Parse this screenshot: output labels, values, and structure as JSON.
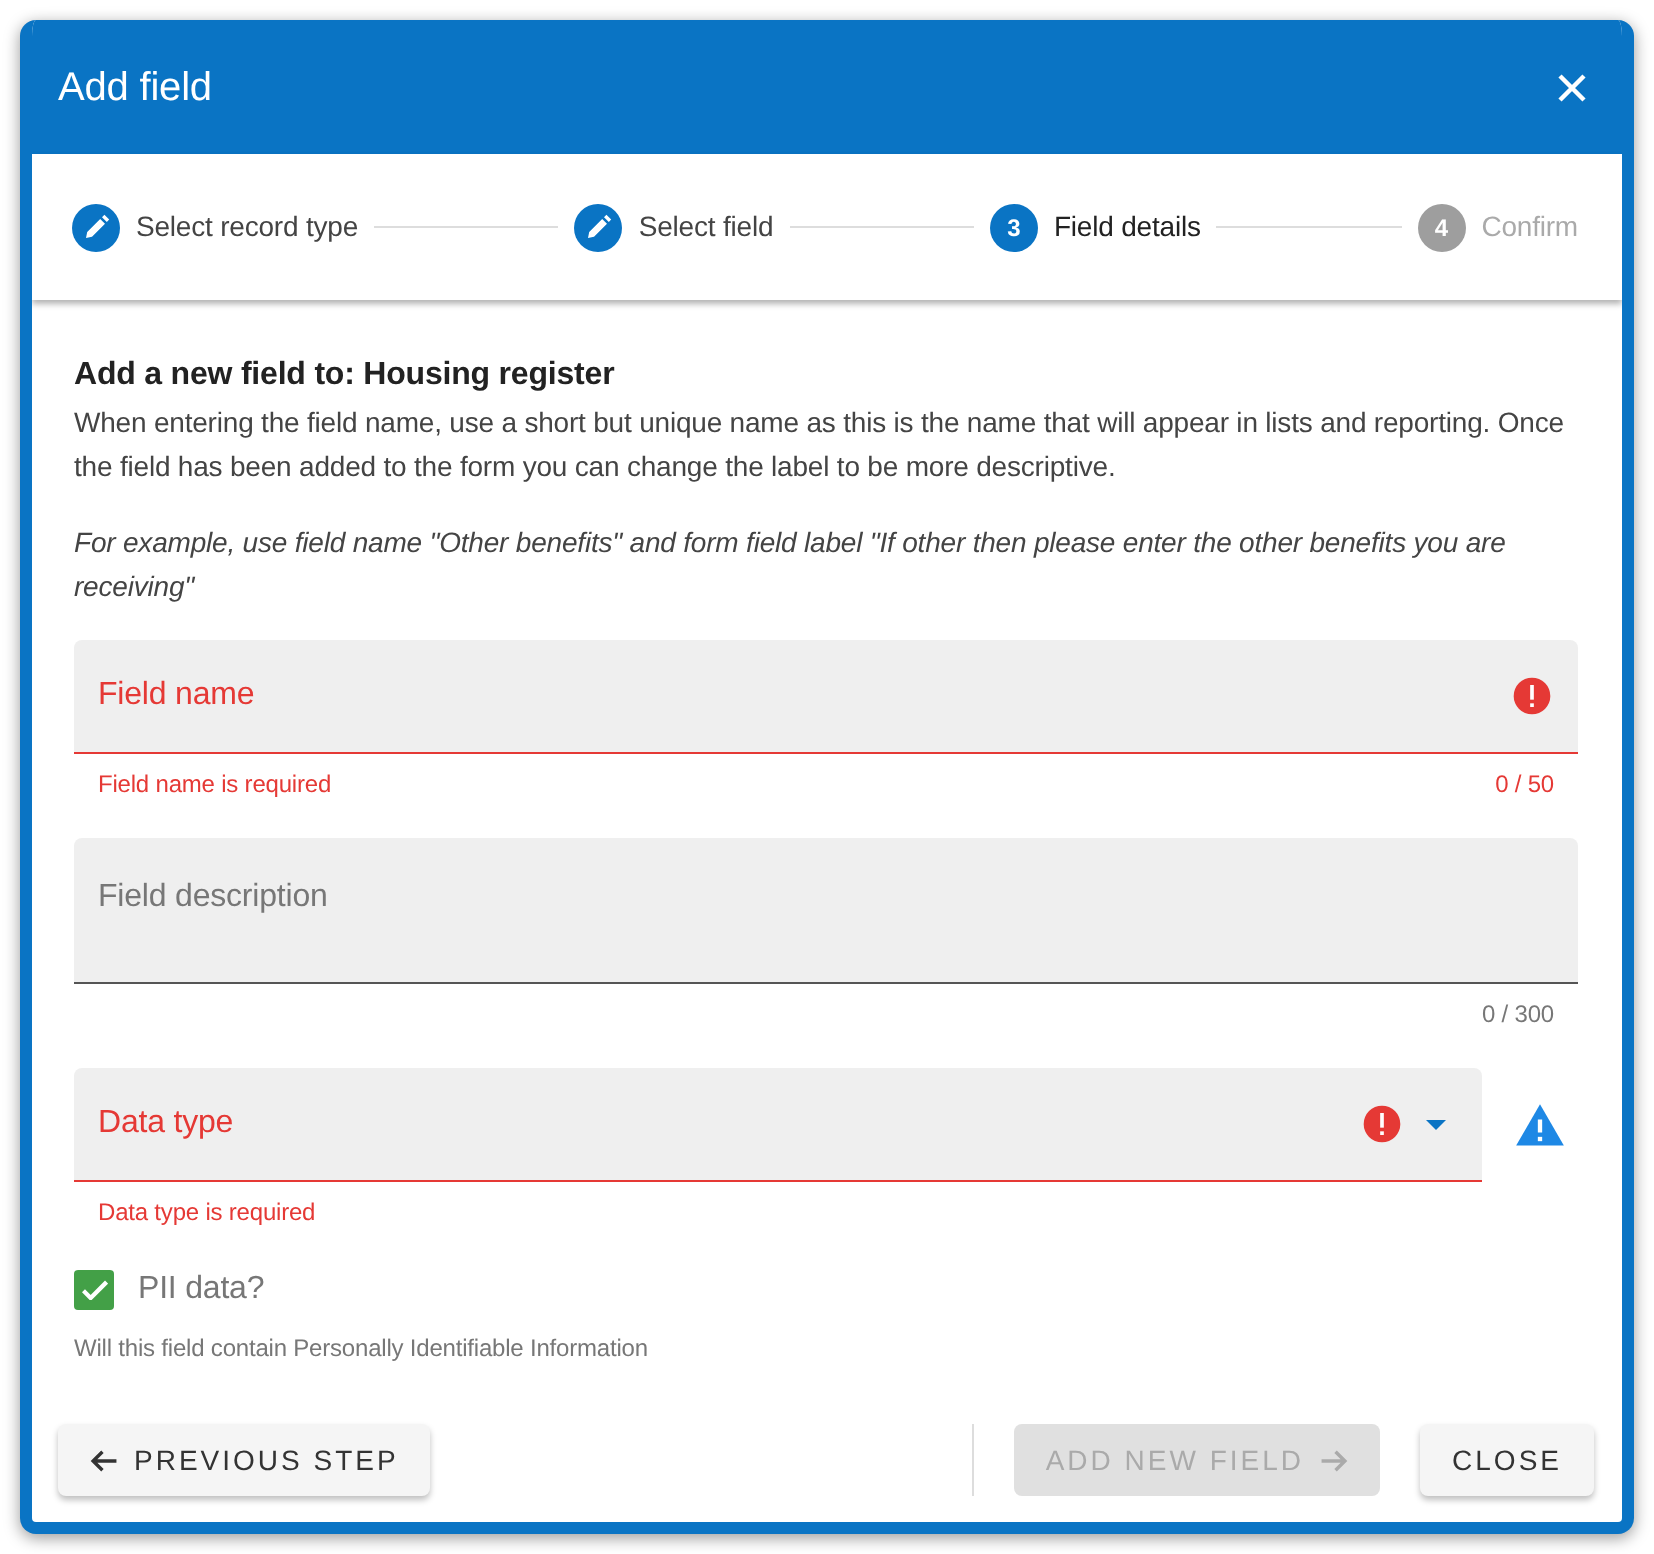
{
  "dialog": {
    "title": "Add field"
  },
  "steps": [
    {
      "label": "Select record type",
      "completed": true,
      "selected": false
    },
    {
      "label": "Select field",
      "completed": true,
      "selected": false
    },
    {
      "label": "Field details",
      "number": "3",
      "completed": false,
      "selected": true
    },
    {
      "label": "Confirm",
      "number": "4",
      "completed": false,
      "selected": false
    }
  ],
  "intro": {
    "heading": "Add a new field to: Housing register",
    "text": "When entering the field name, use a short but unique name as this is the name that will appear in lists and reporting. Once the field has been added to the form you can change the label to be more descriptive.",
    "example": "For example, use field name \"Other benefits\" and form field label \"If other then please enter the other benefits you are receiving\""
  },
  "fields": [
    {
      "kind": "text",
      "label": "Field name",
      "invalid": true,
      "error": "Field name is required",
      "counter": "0 / 50"
    },
    {
      "kind": "textarea",
      "label": "Field description",
      "invalid": false,
      "counter": "0 / 300"
    },
    {
      "kind": "select",
      "label": "Data type",
      "invalid": true,
      "error": "Data type is required",
      "warning": true
    }
  ],
  "checkbox": {
    "label": "PII data?",
    "checked": true,
    "hint": "Will this field contain Personally Identifiable Information"
  },
  "buttons": [
    {
      "kind": "back",
      "label": "PREVIOUS STEP",
      "disabled": false
    },
    {
      "kind": "next",
      "label": "ADD NEW FIELD",
      "disabled": true
    },
    {
      "kind": "plain",
      "label": "CLOSE",
      "disabled": false
    }
  ]
}
